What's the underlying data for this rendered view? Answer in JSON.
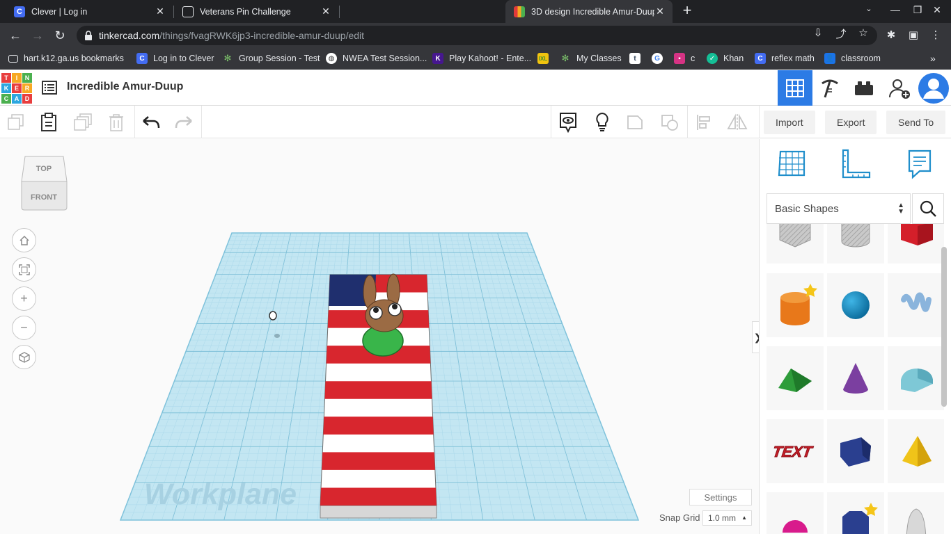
{
  "browser": {
    "tabs": [
      {
        "title": "Clever | Log in",
        "favicon": "clever-c-icon",
        "active": false
      },
      {
        "title": "Veterans Pin Challenge",
        "favicon": "image-icon",
        "active": false
      },
      {
        "title": "",
        "favicon": "",
        "active": false
      },
      {
        "title": "3D design Incredible Amur-Duup",
        "favicon": "tinkercad-icon",
        "active": true
      }
    ],
    "url_host": "tinkercad.com",
    "url_path": "/things/fvagRWK6jp3-incredible-amur-duup/edit",
    "bookmarks": [
      {
        "label": "hart.k12.ga.us bookmarks",
        "icon": "folder-icon"
      },
      {
        "label": "Log in to Clever",
        "icon": "clever-c-icon"
      },
      {
        "label": "Group Session - Test",
        "icon": "palm-icon"
      },
      {
        "label": "NWEA Test Session...",
        "icon": "globe-icon"
      },
      {
        "label": "Play Kahoot! - Ente...",
        "icon": "kahoot-icon"
      },
      {
        "label": "",
        "icon": "ixl-icon"
      },
      {
        "label": "My Classes",
        "icon": "palm-icon"
      },
      {
        "label": "",
        "icon": "tumblr-icon"
      },
      {
        "label": "",
        "icon": "google-icon"
      },
      {
        "label": "c",
        "icon": "classroom-pink-icon"
      },
      {
        "label": "Khan",
        "icon": "khan-icon"
      },
      {
        "label": "reflex math",
        "icon": "clever-c-icon"
      },
      {
        "label": "classroom",
        "icon": "classroom-icon"
      }
    ]
  },
  "app": {
    "logo_letters": [
      "T",
      "I",
      "N",
      "K",
      "E",
      "R",
      "C",
      "A",
      "D"
    ],
    "design_title": "Incredible Amur-Duup",
    "toolbar": {
      "import_label": "Import",
      "export_label": "Export",
      "send_to_label": "Send To"
    },
    "viewcube": {
      "top_label": "TOP",
      "front_label": "FRONT"
    },
    "workplane_label": "Workplane",
    "settings_label": "Settings",
    "snap_grid_label": "Snap Grid",
    "snap_grid_value": "1.0 mm",
    "collapse_glyph": "❯",
    "panel": {
      "category": "Basic Shapes",
      "shapes": [
        "box-hole",
        "cylinder-hole",
        "box",
        "cylinder",
        "sphere",
        "scribble",
        "roof",
        "cone",
        "round-roof",
        "text",
        "hexagonal-prism",
        "pyramid",
        "half-sphere",
        "polygon",
        "paraboloid"
      ],
      "text_shape_label": "TEXT"
    }
  },
  "colors": {
    "accent": "#2c7be5",
    "workplane": "#bfe3f0",
    "grid_line": "#8fcde3",
    "flag_red": "#d8262e",
    "flag_blue": "#1f2f6e"
  }
}
